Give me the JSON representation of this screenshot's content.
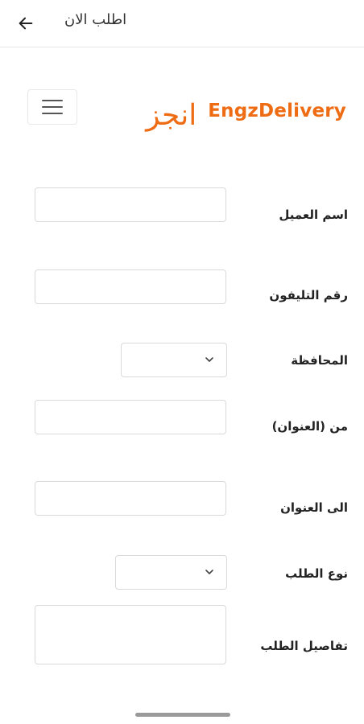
{
  "appbar": {
    "title": "اطلب الان"
  },
  "brand": {
    "name": "EngzDelivery",
    "logo_text": "انجز"
  },
  "form": {
    "customer_name_label": "اسم العميل",
    "phone_label": "رقم التليفون",
    "governorate_label": "المحافظة",
    "from_address_label": "من (العنوان)",
    "to_address_label": "الى العنوان",
    "order_type_label": "نوع الطلب",
    "order_details_label": "تفاصيل الطلب",
    "next_label_partial": "ـــ ـــ ـــ"
  },
  "icons": {
    "back": "arrow-left-icon",
    "menu": "hamburger-menu-icon",
    "dropdown": "chevron-down-icon"
  },
  "colors": {
    "brand": "#ee6c14"
  }
}
